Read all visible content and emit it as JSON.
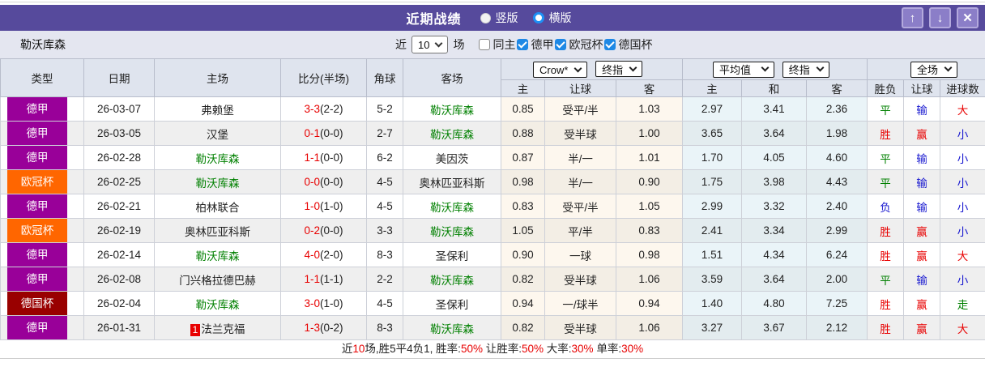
{
  "title_bar": {
    "title": "近期战绩",
    "radios": [
      {
        "label": "竖版",
        "selected": false
      },
      {
        "label": "横版",
        "selected": true
      }
    ],
    "buttons": {
      "up": "↑",
      "down": "↓",
      "close": "✕"
    }
  },
  "team_name": "勒沃库森",
  "filter": {
    "prefix": "近",
    "matches_value": "10",
    "suffix": "场",
    "checkboxes": [
      {
        "label": "同主",
        "checked": false
      },
      {
        "label": "德甲",
        "checked": true
      },
      {
        "label": "欧冠杯",
        "checked": true
      },
      {
        "label": "德国杯",
        "checked": true
      }
    ]
  },
  "colors": {
    "accent_purple": "#564a9c",
    "result_red": "#e80000",
    "result_green": "#008000",
    "result_blue": "#1515cf",
    "leagues": {
      "德甲": "#990099",
      "欧冠杯": "#ff6600",
      "德国杯": "#990000"
    }
  },
  "result_colors": {
    "胜": "red",
    "赢": "red",
    "大": "red",
    "平": "green",
    "走": "green",
    "负": "blue",
    "输": "blue",
    "小": "blue"
  },
  "table": {
    "static_headers": [
      "类型",
      "日期",
      "主场",
      "比分(半场)",
      "角球",
      "客场"
    ],
    "asian_group": {
      "selects": [
        "Crow*",
        "终指"
      ],
      "subheaders": [
        "主",
        "让球",
        "客"
      ]
    },
    "euro_group": {
      "selects": [
        "平均值",
        "终指"
      ],
      "subheaders": [
        "主",
        "和",
        "客"
      ]
    },
    "result_group": {
      "selects": [
        "全场"
      ],
      "subheaders": [
        "胜负",
        "让球",
        "进球数"
      ]
    },
    "rows": [
      {
        "league": "德甲",
        "date": "26-03-07",
        "home": "弗赖堡",
        "home_rank": "",
        "score_ft": "3-3",
        "score_ht": "(2-2)",
        "corner": "5-2",
        "away": "勒沃库森",
        "asian": [
          "0.85",
          "受平/半",
          "1.03"
        ],
        "euro": [
          "2.97",
          "3.41",
          "2.36"
        ],
        "results": [
          "平",
          "输",
          "大"
        ]
      },
      {
        "league": "德甲",
        "date": "26-03-05",
        "home": "汉堡",
        "home_rank": "",
        "score_ft": "0-1",
        "score_ht": "(0-0)",
        "corner": "2-7",
        "away": "勒沃库森",
        "asian": [
          "0.88",
          "受半球",
          "1.00"
        ],
        "euro": [
          "3.65",
          "3.64",
          "1.98"
        ],
        "results": [
          "胜",
          "赢",
          "小"
        ]
      },
      {
        "league": "德甲",
        "date": "26-02-28",
        "home": "勒沃库森",
        "home_rank": "",
        "score_ft": "1-1",
        "score_ht": "(0-0)",
        "corner": "6-2",
        "away": "美因茨",
        "asian": [
          "0.87",
          "半/一",
          "1.01"
        ],
        "euro": [
          "1.70",
          "4.05",
          "4.60"
        ],
        "results": [
          "平",
          "输",
          "小"
        ]
      },
      {
        "league": "欧冠杯",
        "date": "26-02-25",
        "home": "勒沃库森",
        "home_rank": "",
        "score_ft": "0-0",
        "score_ht": "(0-0)",
        "corner": "4-5",
        "away": "奥林匹亚科斯",
        "asian": [
          "0.98",
          "半/一",
          "0.90"
        ],
        "euro": [
          "1.75",
          "3.98",
          "4.43"
        ],
        "results": [
          "平",
          "输",
          "小"
        ]
      },
      {
        "league": "德甲",
        "date": "26-02-21",
        "home": "柏林联合",
        "home_rank": "",
        "score_ft": "1-0",
        "score_ht": "(1-0)",
        "corner": "4-5",
        "away": "勒沃库森",
        "asian": [
          "0.83",
          "受平/半",
          "1.05"
        ],
        "euro": [
          "2.99",
          "3.32",
          "2.40"
        ],
        "results": [
          "负",
          "输",
          "小"
        ]
      },
      {
        "league": "欧冠杯",
        "date": "26-02-19",
        "home": "奥林匹亚科斯",
        "home_rank": "",
        "score_ft": "0-2",
        "score_ht": "(0-0)",
        "corner": "3-3",
        "away": "勒沃库森",
        "asian": [
          "1.05",
          "平/半",
          "0.83"
        ],
        "euro": [
          "2.41",
          "3.34",
          "2.99"
        ],
        "results": [
          "胜",
          "赢",
          "小"
        ]
      },
      {
        "league": "德甲",
        "date": "26-02-14",
        "home": "勒沃库森",
        "home_rank": "",
        "score_ft": "4-0",
        "score_ht": "(2-0)",
        "corner": "8-3",
        "away": "圣保利",
        "asian": [
          "0.90",
          "一球",
          "0.98"
        ],
        "euro": [
          "1.51",
          "4.34",
          "6.24"
        ],
        "results": [
          "胜",
          "赢",
          "大"
        ]
      },
      {
        "league": "德甲",
        "date": "26-02-08",
        "home": "门兴格拉德巴赫",
        "home_rank": "",
        "score_ft": "1-1",
        "score_ht": "(1-1)",
        "corner": "2-2",
        "away": "勒沃库森",
        "asian": [
          "0.82",
          "受半球",
          "1.06"
        ],
        "euro": [
          "3.59",
          "3.64",
          "2.00"
        ],
        "results": [
          "平",
          "输",
          "小"
        ]
      },
      {
        "league": "德国杯",
        "date": "26-02-04",
        "home": "勒沃库森",
        "home_rank": "",
        "score_ft": "3-0",
        "score_ht": "(1-0)",
        "corner": "4-5",
        "away": "圣保利",
        "asian": [
          "0.94",
          "一/球半",
          "0.94"
        ],
        "euro": [
          "1.40",
          "4.80",
          "7.25"
        ],
        "results": [
          "胜",
          "赢",
          "走"
        ]
      },
      {
        "league": "德甲",
        "date": "26-01-31",
        "home": "法兰克福",
        "home_rank": "1",
        "score_ft": "1-3",
        "score_ht": "(0-2)",
        "corner": "8-3",
        "away": "勒沃库森",
        "asian": [
          "0.82",
          "受半球",
          "1.06"
        ],
        "euro": [
          "3.27",
          "3.67",
          "2.12"
        ],
        "results": [
          "胜",
          "赢",
          "大"
        ]
      }
    ]
  },
  "summary": {
    "segments": [
      {
        "text": "近",
        "red": false
      },
      {
        "text": "10",
        "red": true
      },
      {
        "text": "场,胜5平4负1, 胜率:",
        "red": false
      },
      {
        "text": "50%",
        "red": true
      },
      {
        "text": " 让胜率:",
        "red": false
      },
      {
        "text": "50%",
        "red": true
      },
      {
        "text": " 大率:",
        "red": false
      },
      {
        "text": "30%",
        "red": true
      },
      {
        "text": " 单率:",
        "red": false
      },
      {
        "text": "30%",
        "red": true
      }
    ]
  }
}
